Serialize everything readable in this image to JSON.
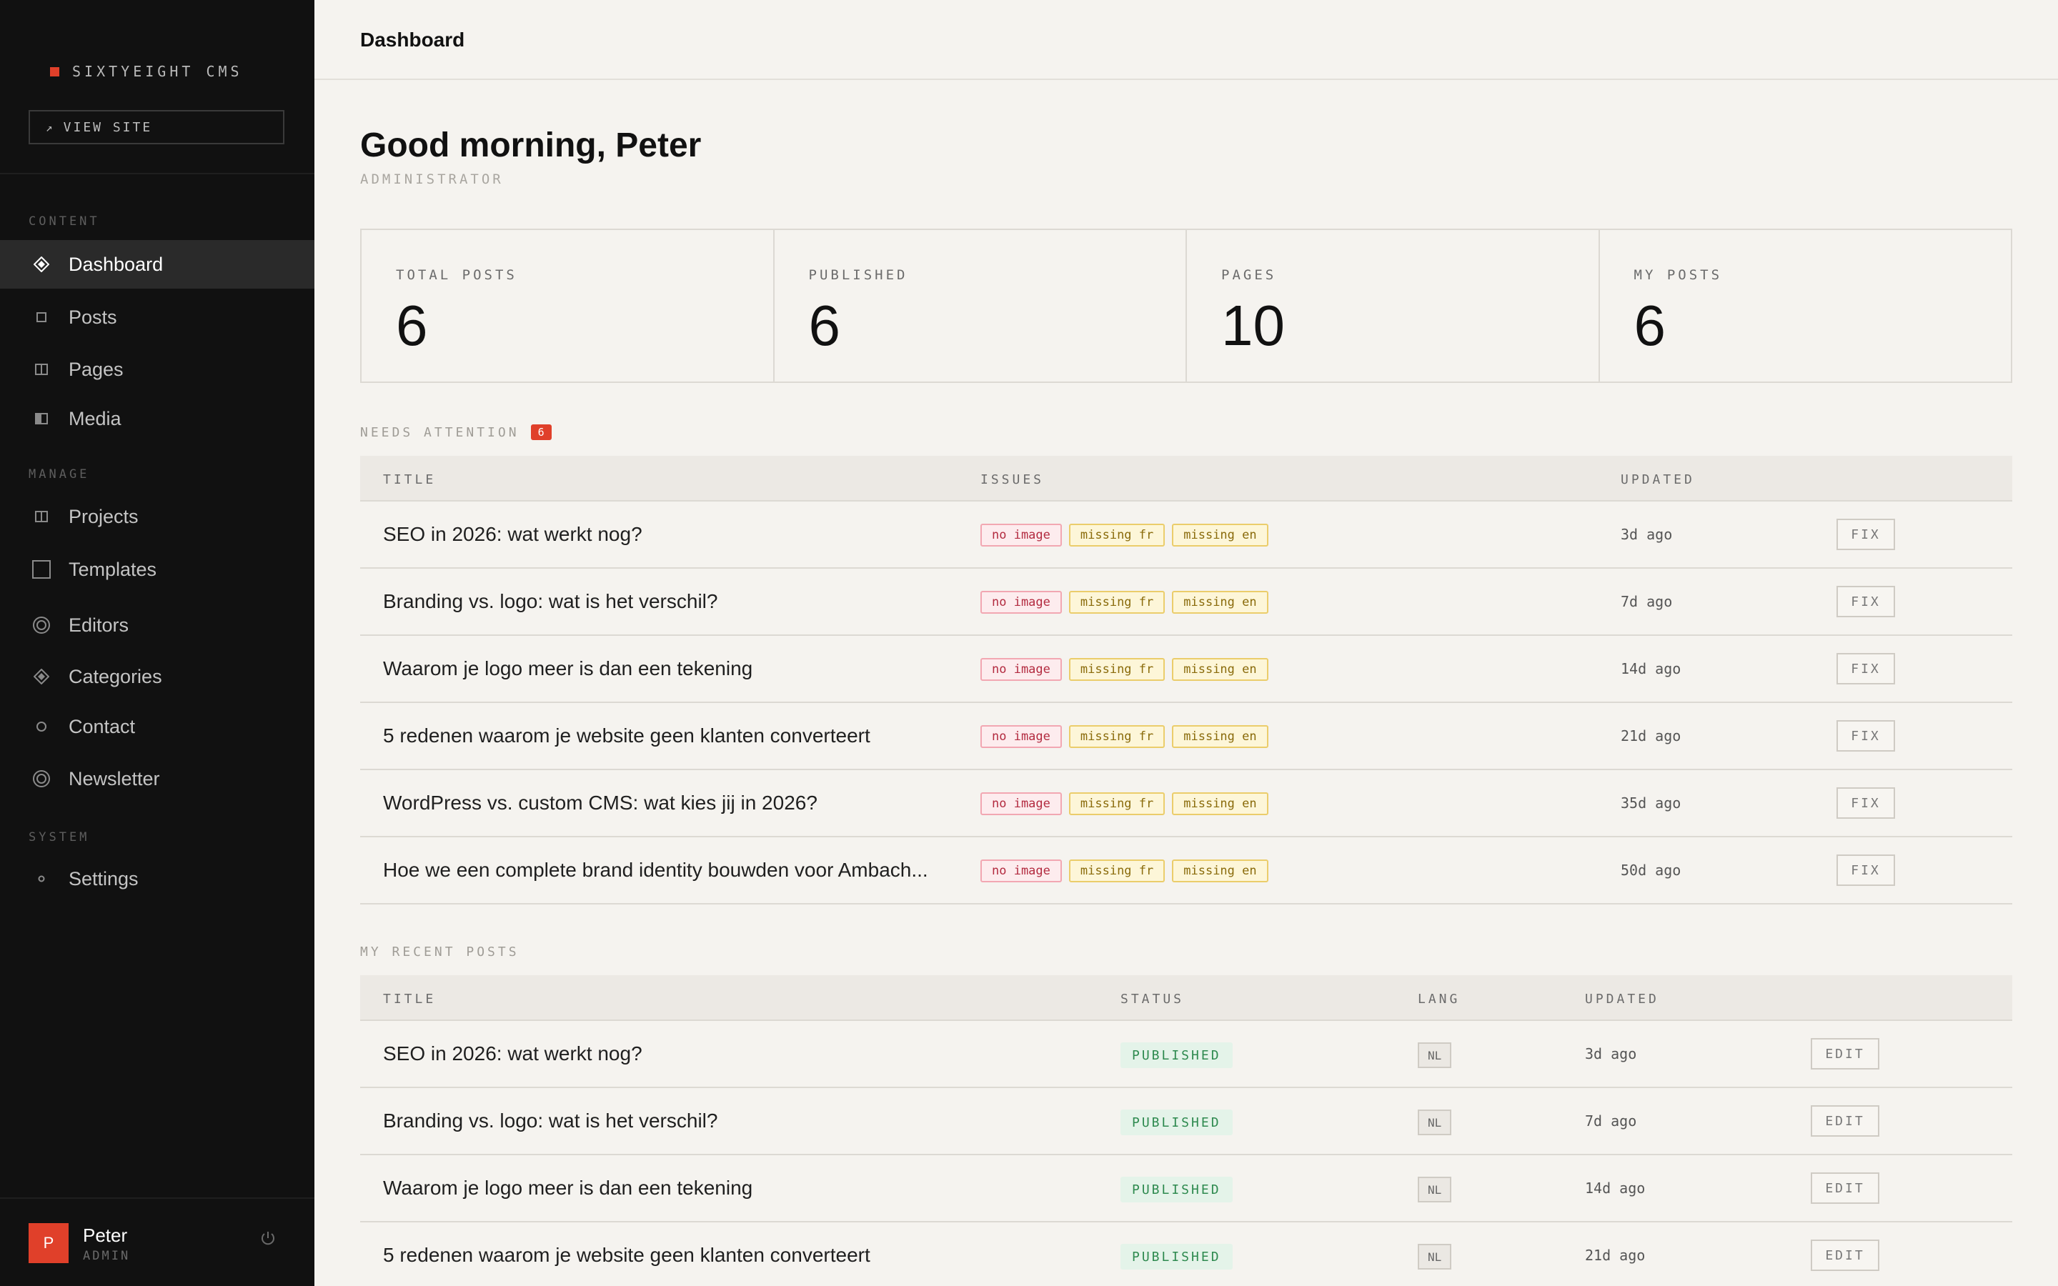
{
  "sidebar": {
    "brand": "SIXTYEIGHT CMS",
    "view_site": "VIEW SITE",
    "sections": {
      "content": "CONTENT",
      "manage": "MANAGE",
      "system": "SYSTEM"
    },
    "items": {
      "dashboard": "Dashboard",
      "posts": "Posts",
      "pages": "Pages",
      "media": "Media",
      "projects": "Projects",
      "templates": "Templates",
      "editors": "Editors",
      "categories": "Categories",
      "contact": "Contact",
      "newsletter": "Newsletter",
      "settings": "Settings"
    },
    "user": {
      "initial": "P",
      "name": "Peter",
      "role": "ADMIN"
    }
  },
  "header": {
    "title": "Dashboard"
  },
  "main": {
    "greeting": "Good morning, Peter",
    "role": "ADMINISTRATOR",
    "stats": [
      {
        "label": "TOTAL POSTS",
        "value": "6"
      },
      {
        "label": "PUBLISHED",
        "value": "6"
      },
      {
        "label": "PAGES",
        "value": "10"
      },
      {
        "label": "MY POSTS",
        "value": "6"
      }
    ],
    "attention": {
      "label": "NEEDS ATTENTION",
      "count": "6",
      "columns": {
        "title": "TITLE",
        "issues": "ISSUES",
        "updated": "UPDATED"
      },
      "issue_labels": {
        "no_image": "no image",
        "missing_fr": "missing fr",
        "missing_en": "missing en"
      },
      "action_label": "FIX",
      "rows": [
        {
          "title": "SEO in 2026: wat werkt nog?",
          "updated": "3d ago"
        },
        {
          "title": "Branding vs. logo: wat is het verschil?",
          "updated": "7d ago"
        },
        {
          "title": "Waarom je logo meer is dan een tekening",
          "updated": "14d ago"
        },
        {
          "title": "5 redenen waarom je website geen klanten converteert",
          "updated": "21d ago"
        },
        {
          "title": "WordPress vs. custom CMS: wat kies jij in 2026?",
          "updated": "35d ago"
        },
        {
          "title": "Hoe we een complete brand identity bouwden voor Ambach...",
          "updated": "50d ago"
        }
      ]
    },
    "recent": {
      "label": "MY RECENT POSTS",
      "columns": {
        "title": "TITLE",
        "status": "STATUS",
        "lang": "LANG",
        "updated": "UPDATED"
      },
      "action_label": "EDIT",
      "rows": [
        {
          "title": "SEO in 2026: wat werkt nog?",
          "status": "PUBLISHED",
          "lang": "NL",
          "updated": "3d ago"
        },
        {
          "title": "Branding vs. logo: wat is het verschil?",
          "status": "PUBLISHED",
          "lang": "NL",
          "updated": "7d ago"
        },
        {
          "title": "Waarom je logo meer is dan een tekening",
          "status": "PUBLISHED",
          "lang": "NL",
          "updated": "14d ago"
        },
        {
          "title": "5 redenen waarom je website geen klanten converteert",
          "status": "PUBLISHED",
          "lang": "NL",
          "updated": "21d ago"
        }
      ]
    }
  },
  "colors": {
    "accent": "#e0402a",
    "sidebar_bg": "#111111",
    "page_bg": "#f5f3ef",
    "published": "#2e8a4f"
  },
  "icons": {
    "dashboard": "diamond-icon",
    "posts": "square-icon",
    "pages": "columns-icon",
    "media": "half-square-icon",
    "projects": "columns-icon",
    "templates": "square-outline-icon",
    "editors": "ring-icon",
    "categories": "diamond-icon",
    "contact": "circle-icon",
    "newsletter": "ring-icon",
    "settings": "dot-icon",
    "view_site": "arrow-up-right-icon",
    "logout": "power-icon"
  }
}
